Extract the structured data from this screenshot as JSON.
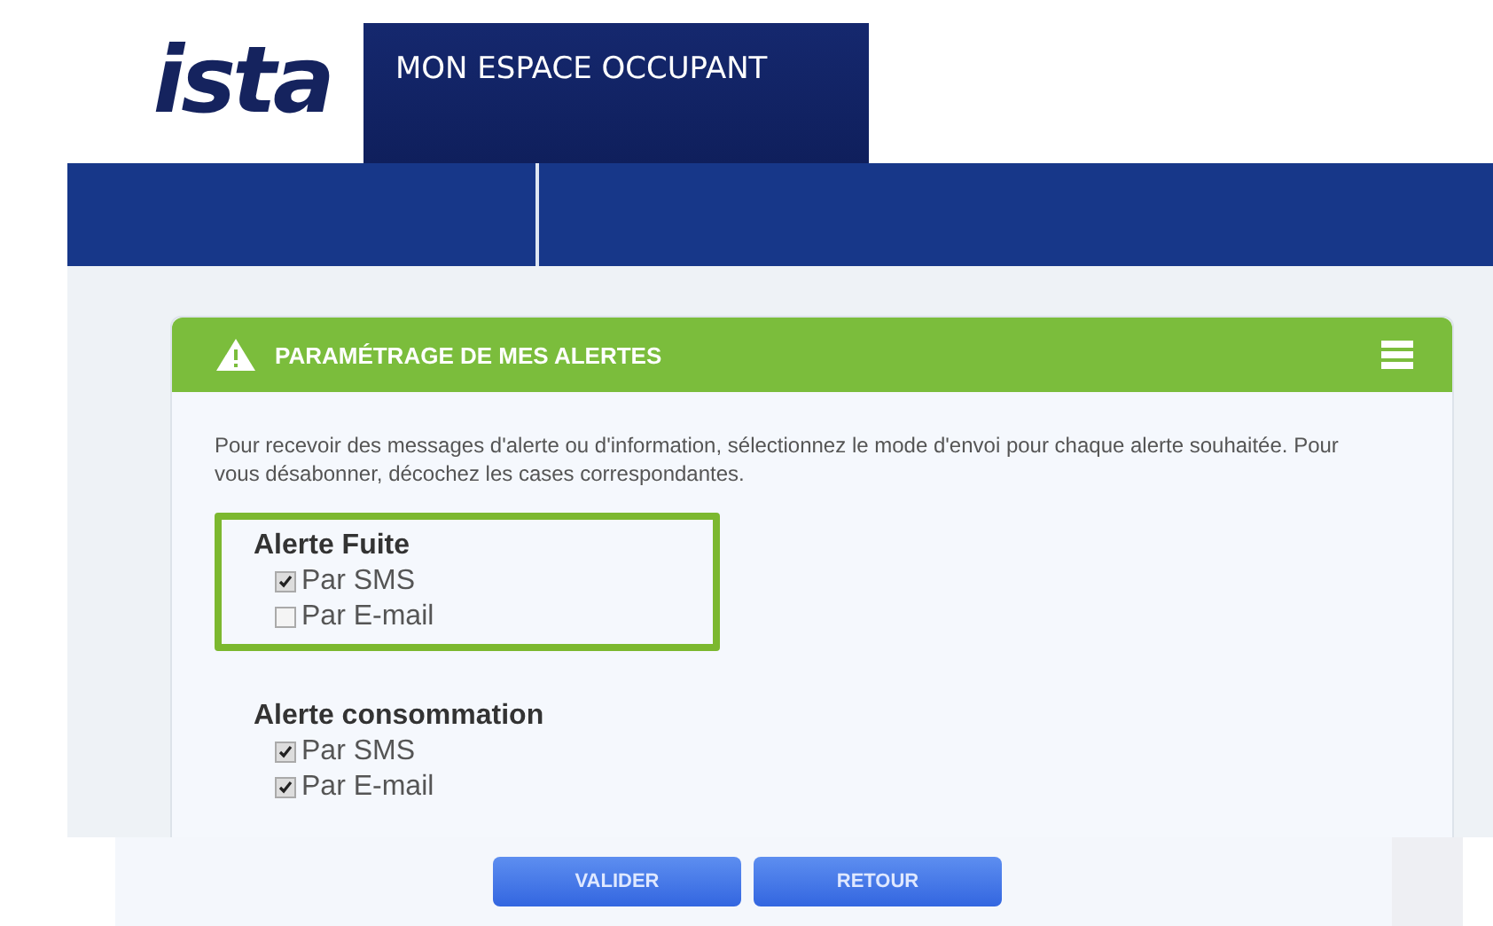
{
  "logo": "ista",
  "header": {
    "title": "MON ESPACE OCCUPANT"
  },
  "panel": {
    "title": "PARAMÉTRAGE DE MES ALERTES",
    "intro": "Pour recevoir des messages d'alerte ou d'information, sélectionnez le mode d'envoi pour chaque alerte souhaitée. Pour vous désabonner, décochez les cases correspondantes.",
    "groups": [
      {
        "title": "Alerte Fuite",
        "highlighted": true,
        "options": [
          {
            "label": "Par SMS",
            "checked": true
          },
          {
            "label": "Par E-mail",
            "checked": false
          }
        ]
      },
      {
        "title": "Alerte consommation",
        "highlighted": false,
        "options": [
          {
            "label": "Par SMS",
            "checked": true
          },
          {
            "label": "Par E-mail",
            "checked": true
          }
        ]
      }
    ]
  },
  "buttons": [
    "VALIDER",
    "RETOUR"
  ]
}
